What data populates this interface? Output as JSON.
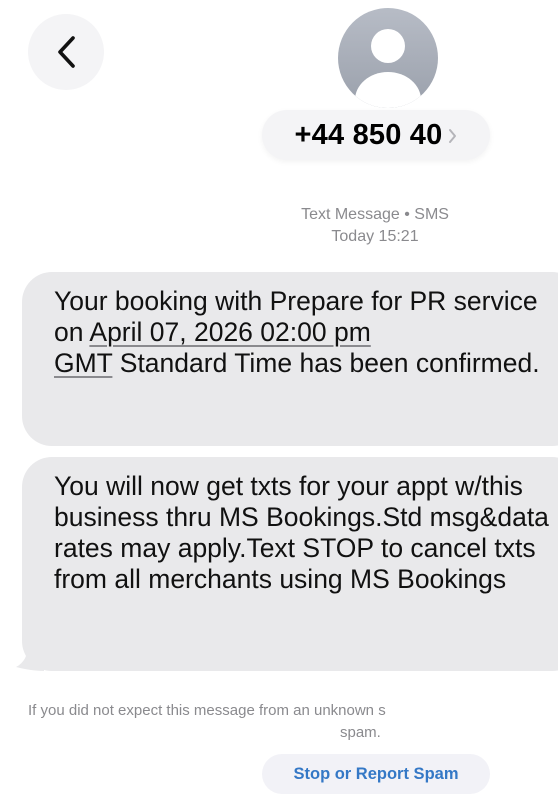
{
  "header": {
    "back_icon": "chevron-left-icon",
    "avatar_icon": "person-silhouette-icon",
    "contact_number": "+44 850 40",
    "contact_chevron_icon": "chevron-right-icon"
  },
  "conversation": {
    "service_label": "Text Message • SMS",
    "timestamp": "Today 15:21",
    "messages": [
      {
        "text_before_link": "Your booking with Prepare for PR service on ",
        "link_line1": "April 07, 2026 02:00 pm",
        "link_line2": "GMT",
        "text_after_link": " Standard Time has been confirmed."
      },
      {
        "text": "You will now get txts for your appt w/this business thru MS Bookings.Std msg&data rates may apply.Text STOP to cancel txts from all merchants using MS Bookings"
      }
    ]
  },
  "footer": {
    "notice_line1": "If you did not expect this message from an unknown s",
    "notice_line2": "spam.",
    "report_button_label": "Stop or Report Spam"
  },
  "colors": {
    "bubble_background": "#e9e9eb",
    "meta_text": "#8a8a8e",
    "link_blue": "#3478c6",
    "avatar_gray": "#9aa0ab"
  }
}
